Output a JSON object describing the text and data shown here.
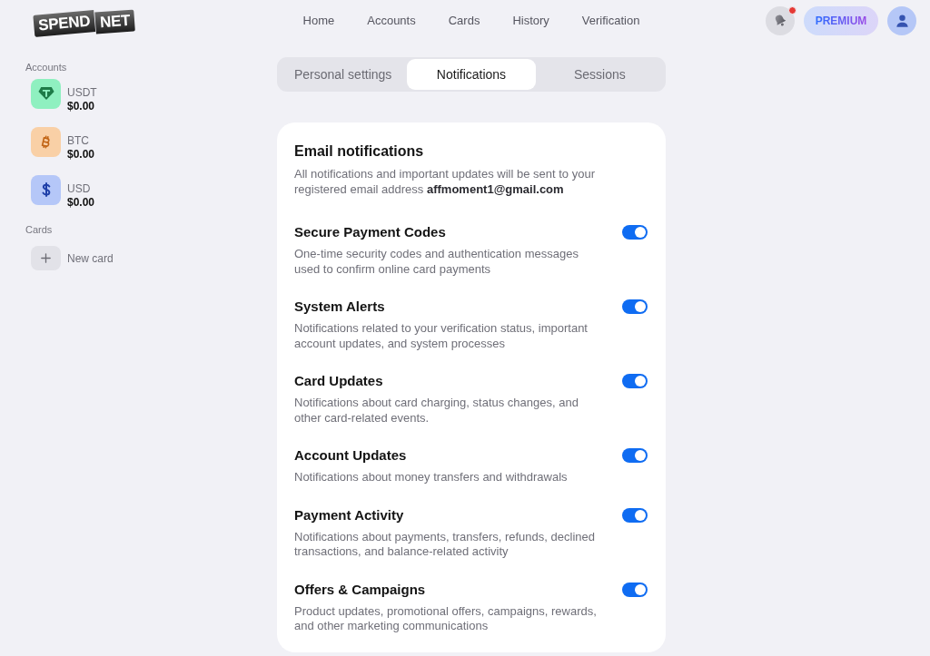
{
  "header": {
    "logo": [
      "SPEND",
      "NET"
    ],
    "nav": [
      "Home",
      "Accounts",
      "Cards",
      "History",
      "Verification"
    ],
    "notifications": {
      "unread": true
    },
    "premium_label": "PREMIUM"
  },
  "sidebar": {
    "accounts": {
      "heading": "Accounts",
      "items": [
        {
          "kind": "usdt",
          "name": "USDT",
          "balance": "$0.00"
        },
        {
          "kind": "btc",
          "name": "BTC",
          "balance": "$0.00"
        },
        {
          "kind": "usd",
          "name": "USD",
          "balance": "$0.00"
        }
      ]
    },
    "cards": {
      "heading": "Cards",
      "new_card": "New card"
    }
  },
  "settings_tabs": [
    {
      "label": "Personal settings",
      "selected": false
    },
    {
      "label": "Notifications",
      "selected": true
    },
    {
      "label": "Sessions",
      "selected": false
    }
  ],
  "email_notifications": {
    "title": "Email notifications",
    "description": "All notifications and important updates will be sent to your registered email address **affmoment1@gmail.com**",
    "items": [
      {
        "title": "Secure Payment Codes",
        "description": "One-time security codes and authentication messages used to confirm online card payments",
        "on": true
      },
      {
        "title": "System Alerts",
        "description": "Notifications related to your verification status, important account updates, and system processes",
        "on": true
      },
      {
        "title": "Card Updates",
        "description": "Notifications about card charging, status changes, and other card-related events.",
        "on": true
      },
      {
        "title": "Account Updates",
        "description": "Notifications about money transfers and withdrawals",
        "on": true
      },
      {
        "title": "Payment Activity",
        "description": "Notifications about payments, transfers, refunds, declined transactions, and balance-related activity",
        "on": true
      },
      {
        "title": "Offers & Campaigns",
        "description": "Product updates, promotional offers, campaigns, rewards, and other marketing communications",
        "on": true
      }
    ]
  }
}
